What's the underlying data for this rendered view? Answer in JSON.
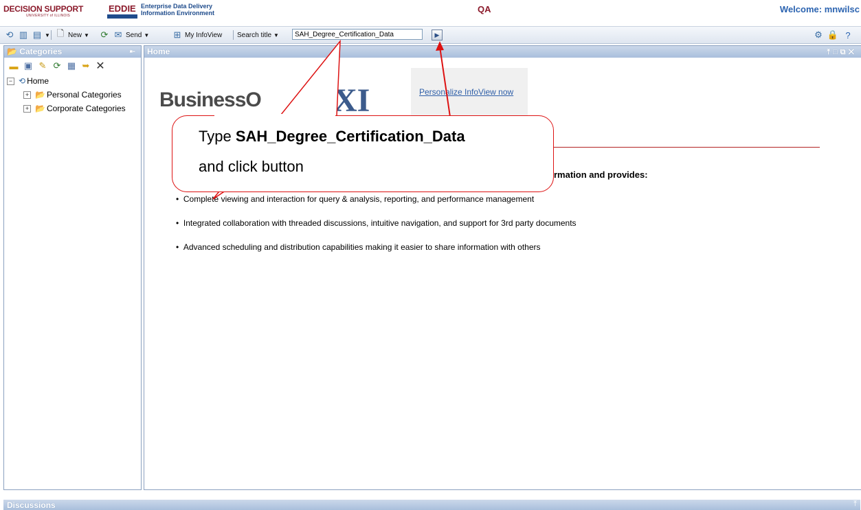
{
  "header": {
    "org_logo": "DECISION SUPPORT",
    "org_sub": "UNIVERSITY of ILLINOIS",
    "app_name": "EDDIE",
    "app_full_line1": "Enterprise Data Delivery",
    "app_full_line2": "Information Environment",
    "environment": "QA",
    "welcome": "Welcome: mnwilsc"
  },
  "toolbar": {
    "new_label": "New",
    "send_label": "Send",
    "myinfoview_label": "My InfoView",
    "search_mode_label": "Search title",
    "search_value": "SAH_Degree_Certification_Data"
  },
  "left_panel": {
    "title": "Categories",
    "tree": {
      "root": "Home",
      "children": [
        "Personal Categories",
        "Corporate Categories"
      ]
    }
  },
  "main": {
    "title": "Home",
    "logo_text": "BusinessO",
    "logo_xi": "XI",
    "personalize_link": "Personalize InfoView now",
    "intro": "rmation and provides:",
    "bullets": [
      "Complete viewing and interaction for query & analysis, reporting, and performance management",
      "Integrated collaboration with threaded discussions, intuitive navigation, and support for 3rd party documents",
      "Advanced scheduling and distribution capabilities making it easier to share information with others"
    ]
  },
  "discussions": {
    "title": "Discussions"
  },
  "callout": {
    "line1_prefix": "Type ",
    "line1_bold": "SAH_Degree_Certification_Data",
    "line2": "and click button"
  },
  "colors": {
    "brand_maroon": "#8b1a2b",
    "brand_blue": "#1f4c8c",
    "panel_header": "#a9bfdc",
    "annotation_red": "#dd1111"
  },
  "icons": [
    "home-icon",
    "folder-icon",
    "refresh-icon",
    "delete-icon",
    "search-go-icon",
    "help-icon",
    "lock-icon",
    "preferences-icon"
  ]
}
